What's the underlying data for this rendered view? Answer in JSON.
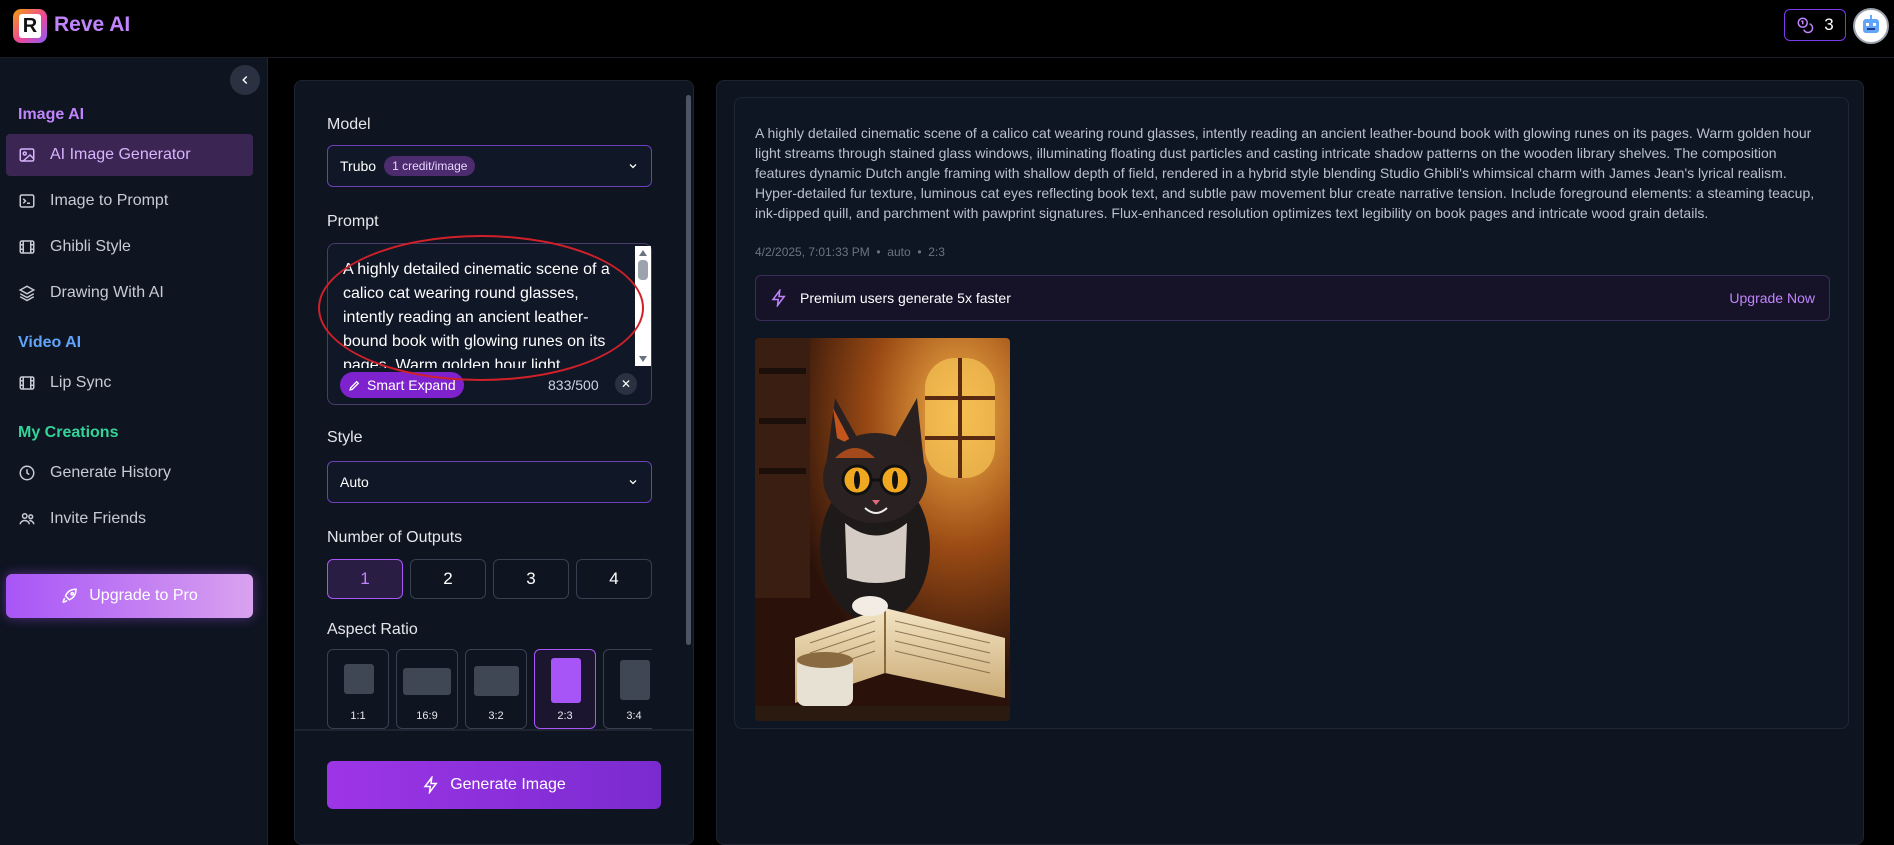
{
  "app": {
    "name": "Reve AI",
    "logo_letter": "R"
  },
  "header": {
    "credits": "3"
  },
  "sidebar": {
    "sections": [
      {
        "title": "Image AI",
        "color": "#c084fc"
      },
      {
        "title": "Video AI",
        "color": "#60a5fa"
      },
      {
        "title": "My Creations",
        "color": "#34d399"
      }
    ],
    "items": [
      {
        "label": "AI Image Generator",
        "icon": "image-icon",
        "active": true
      },
      {
        "label": "Image to Prompt",
        "icon": "terminal-icon"
      },
      {
        "label": "Ghibli Style",
        "icon": "film-icon"
      },
      {
        "label": "Drawing With AI",
        "icon": "layers-icon"
      },
      {
        "label": "Lip Sync",
        "icon": "film-icon"
      },
      {
        "label": "Generate History",
        "icon": "clock-icon"
      },
      {
        "label": "Invite Friends",
        "icon": "users-icon"
      }
    ],
    "upgrade_label": "Upgrade to Pro"
  },
  "settings": {
    "model_label": "Model",
    "model_value": "Trubo",
    "model_badge": "1 credit/image",
    "prompt_label": "Prompt",
    "prompt_text": "A highly detailed cinematic scene of a calico cat wearing round glasses, intently reading an ancient leather-bound book with glowing runes on its pages. Warm golden hour light...",
    "smart_expand": "Smart Expand",
    "char_count": "833/500",
    "style_label": "Style",
    "style_value": "Auto",
    "outputs_label": "Number of Outputs",
    "outputs": [
      "1",
      "2",
      "3",
      "4"
    ],
    "outputs_selected": "1",
    "aspect_label": "Aspect Ratio",
    "aspect_ratios": [
      "1:1",
      "16:9",
      "3:2",
      "2:3",
      "3:4"
    ],
    "aspect_selected": "2:3",
    "generate_label": "Generate Image"
  },
  "result": {
    "prompt": "A highly detailed cinematic scene of a calico cat wearing round glasses, intently reading an ancient leather-bound book with glowing runes on its pages. Warm golden hour light streams through stained glass windows, illuminating floating dust particles and casting intricate shadow patterns on the wooden library shelves. The composition features dynamic Dutch angle framing with shallow depth of field, rendered in a hybrid style blending Studio Ghibli's whimsical charm with James Jean's lyrical realism. Hyper-detailed fur texture, luminous cat eyes reflecting book text, and subtle paw movement blur create narrative tension. Include foreground elements: a steaming teacup, ink-dipped quill, and parchment with pawprint signatures. Flux-enhanced resolution optimizes text legibility on book pages and intricate wood grain details.",
    "date": "4/2/2025, 7:01:33 PM",
    "style": "auto",
    "ratio": "2:3",
    "premium_text": "Premium users generate 5x faster",
    "upgrade_link": "Upgrade Now"
  },
  "colors": {
    "accent": "#a855f7",
    "background": "#000000",
    "panel": "#0e1420"
  }
}
